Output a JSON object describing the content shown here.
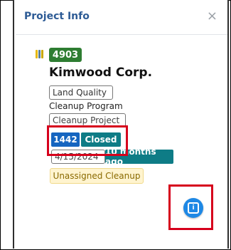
{
  "panel": {
    "title": "Project Info",
    "close_symbol": "×"
  },
  "project": {
    "id": "4903",
    "company": "Kimwood Corp.",
    "category": "Land Quality",
    "program": "Cleanup Program",
    "project_type": "Cleanup Project",
    "record_number": "1442",
    "status": "Closed",
    "date": "4/15/2024",
    "relative_time": "10 months ago",
    "assignment": "Unassigned Cleanup"
  },
  "icons": {
    "project_icon": "bar-chart-icon",
    "info_fab_icon": "info-icon"
  },
  "colors": {
    "title": "#2d5b95",
    "id_badge": "#2e7d32",
    "record_badge": "#1565c0",
    "status_badge": "#0e7c86",
    "highlight": "#d6001c",
    "fab": "#1e88e5"
  }
}
